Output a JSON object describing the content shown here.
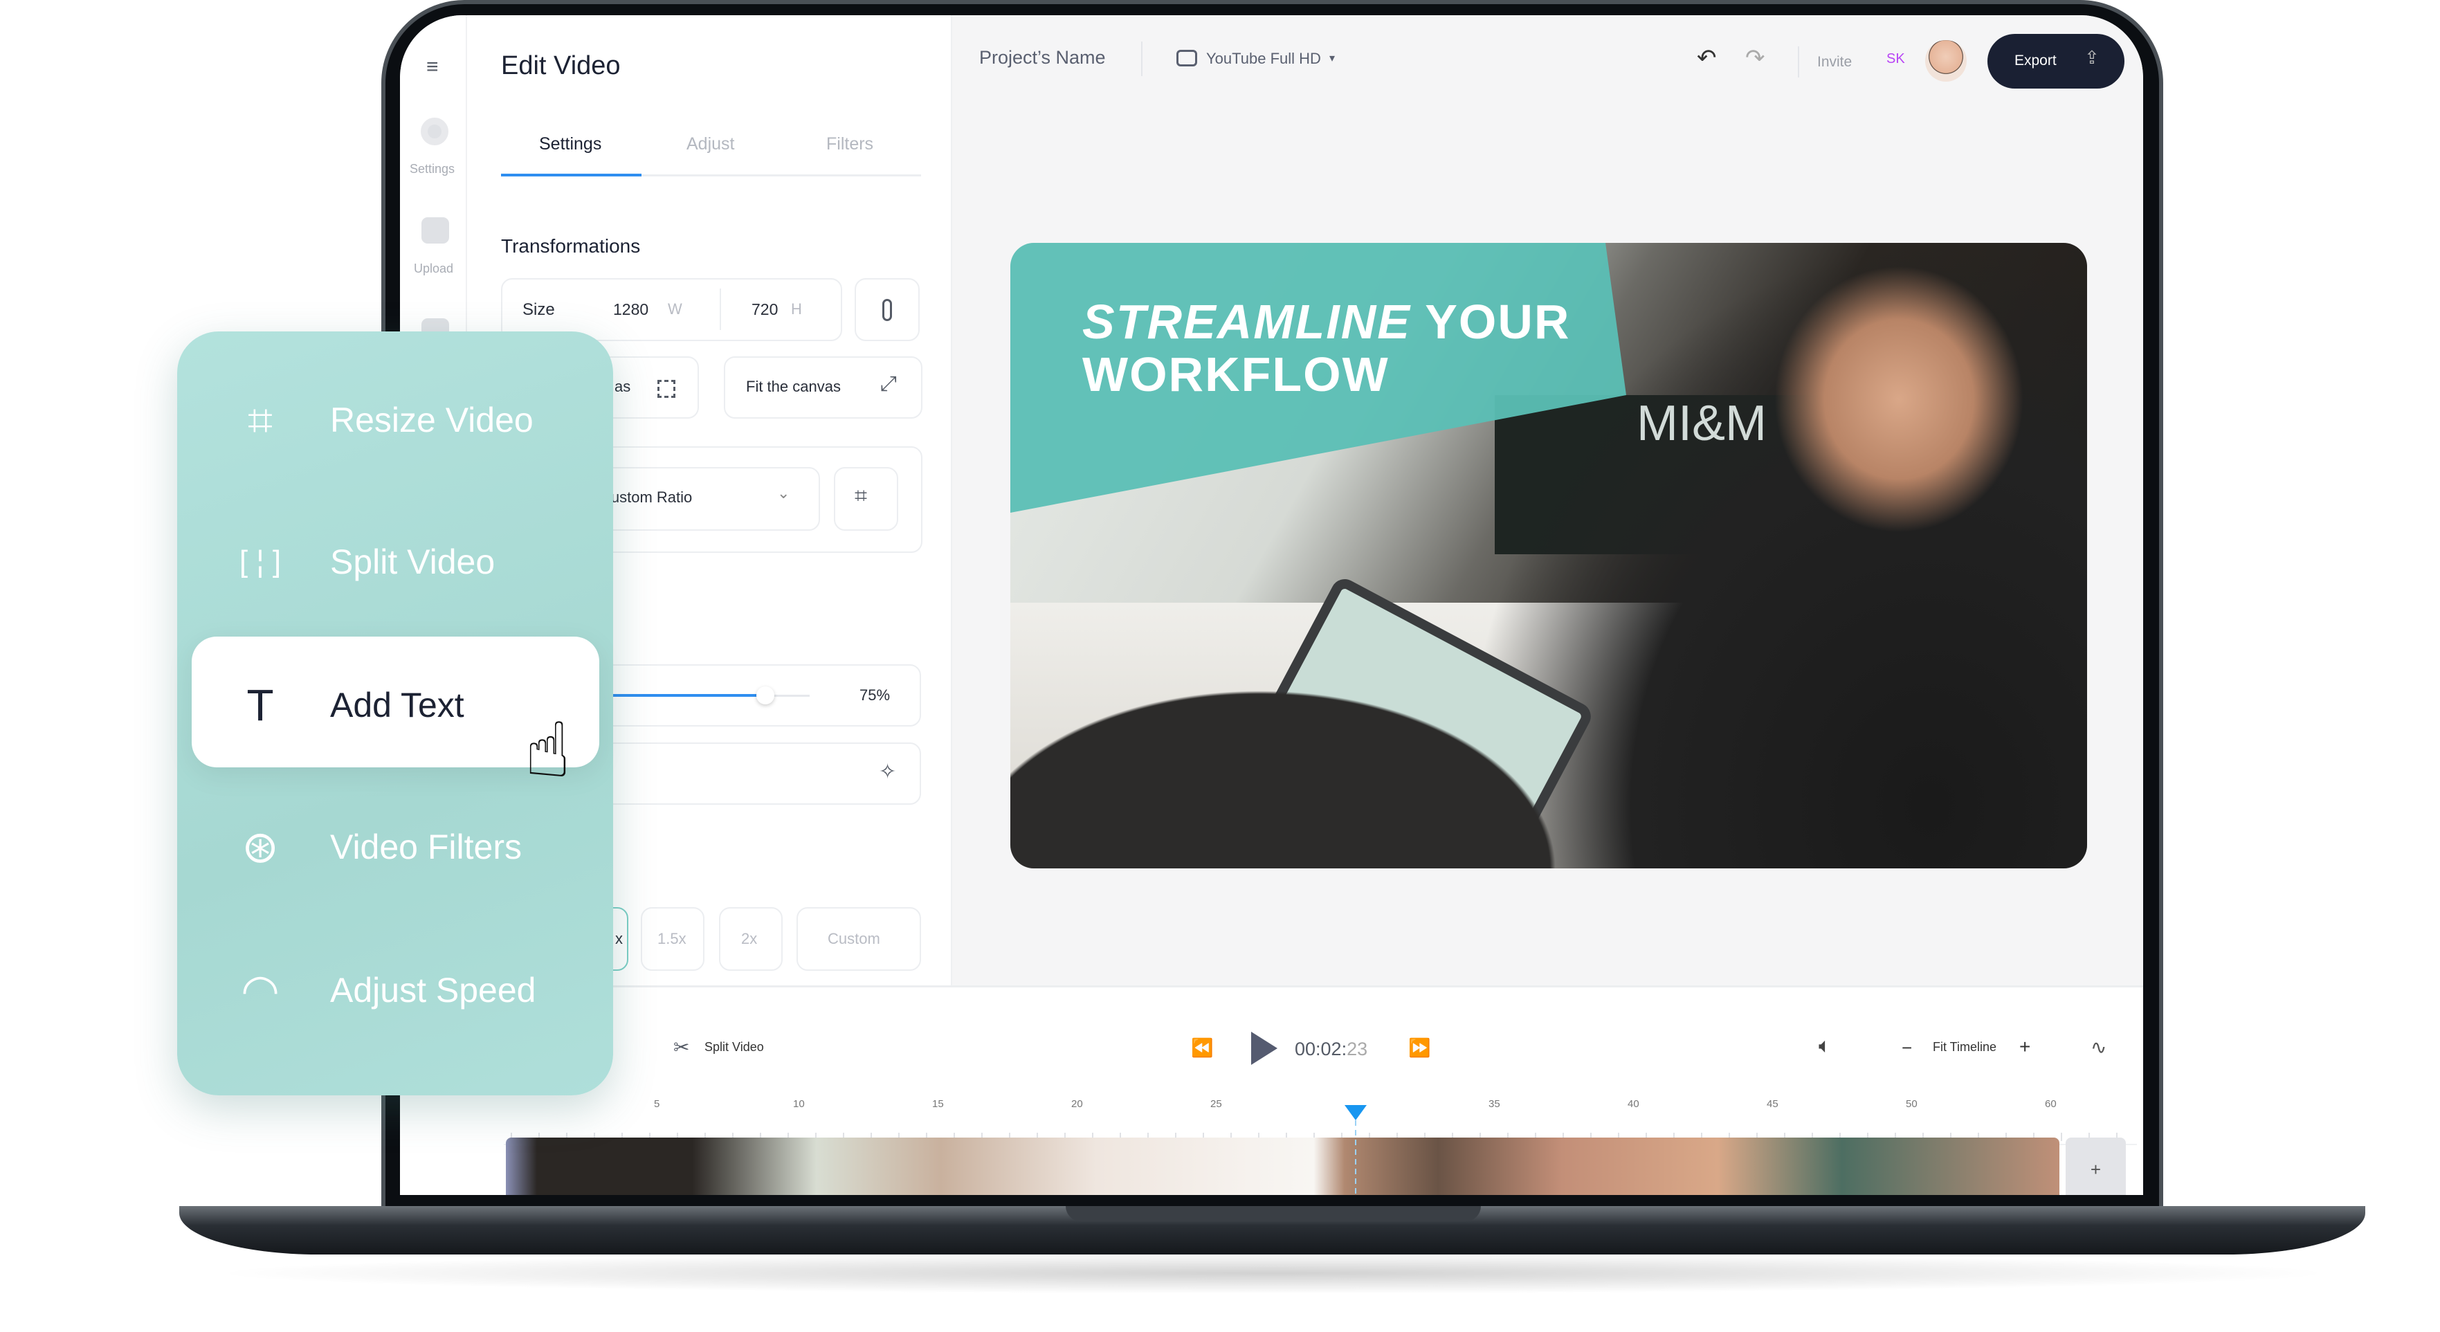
{
  "rail": {
    "settings_label": "Settings",
    "upload_label": "Upload"
  },
  "panel": {
    "title": "Edit Video",
    "tabs": [
      {
        "label": "Settings",
        "active": true
      },
      {
        "label": "Adjust"
      },
      {
        "label": "Filters"
      }
    ],
    "section": "Transformations",
    "size": {
      "label": "Size",
      "width": "1280",
      "w_unit": "W",
      "height": "720",
      "h_unit": "H"
    },
    "fill_fragment": "as",
    "fit_label": "Fit the canvas",
    "ratio": "Custom Ratio",
    "slider": {
      "value": 75,
      "label": "75%"
    },
    "speeds": [
      "x",
      "1.5x",
      "2x",
      "Custom"
    ]
  },
  "header": {
    "project": "Project’s Name",
    "preset": "YouTube Full HD",
    "invite": "Invite",
    "user_initials": "SK",
    "export": "Export"
  },
  "video": {
    "headline_1a": "STREAMLINE",
    "headline_1b": "YOUR",
    "headline_2": "WORKFLOW",
    "sign": "MI&M"
  },
  "timeline": {
    "split": "Split Video",
    "time": "00:02:",
    "time_frames": "23",
    "fit": "Fit Timeline",
    "ticks": [
      "5",
      "10",
      "15",
      "20",
      "25",
      "35",
      "40",
      "45",
      "50",
      "60"
    ]
  },
  "menu": {
    "items": [
      "Resize Video",
      "Split Video",
      "Add Text",
      "Video Filters",
      "Adjust Speed"
    ]
  },
  "colors": {
    "accent": "#2f8ef0",
    "teal": "#5bbfb5",
    "dark": "#1a2033",
    "user": "#b845f5"
  }
}
